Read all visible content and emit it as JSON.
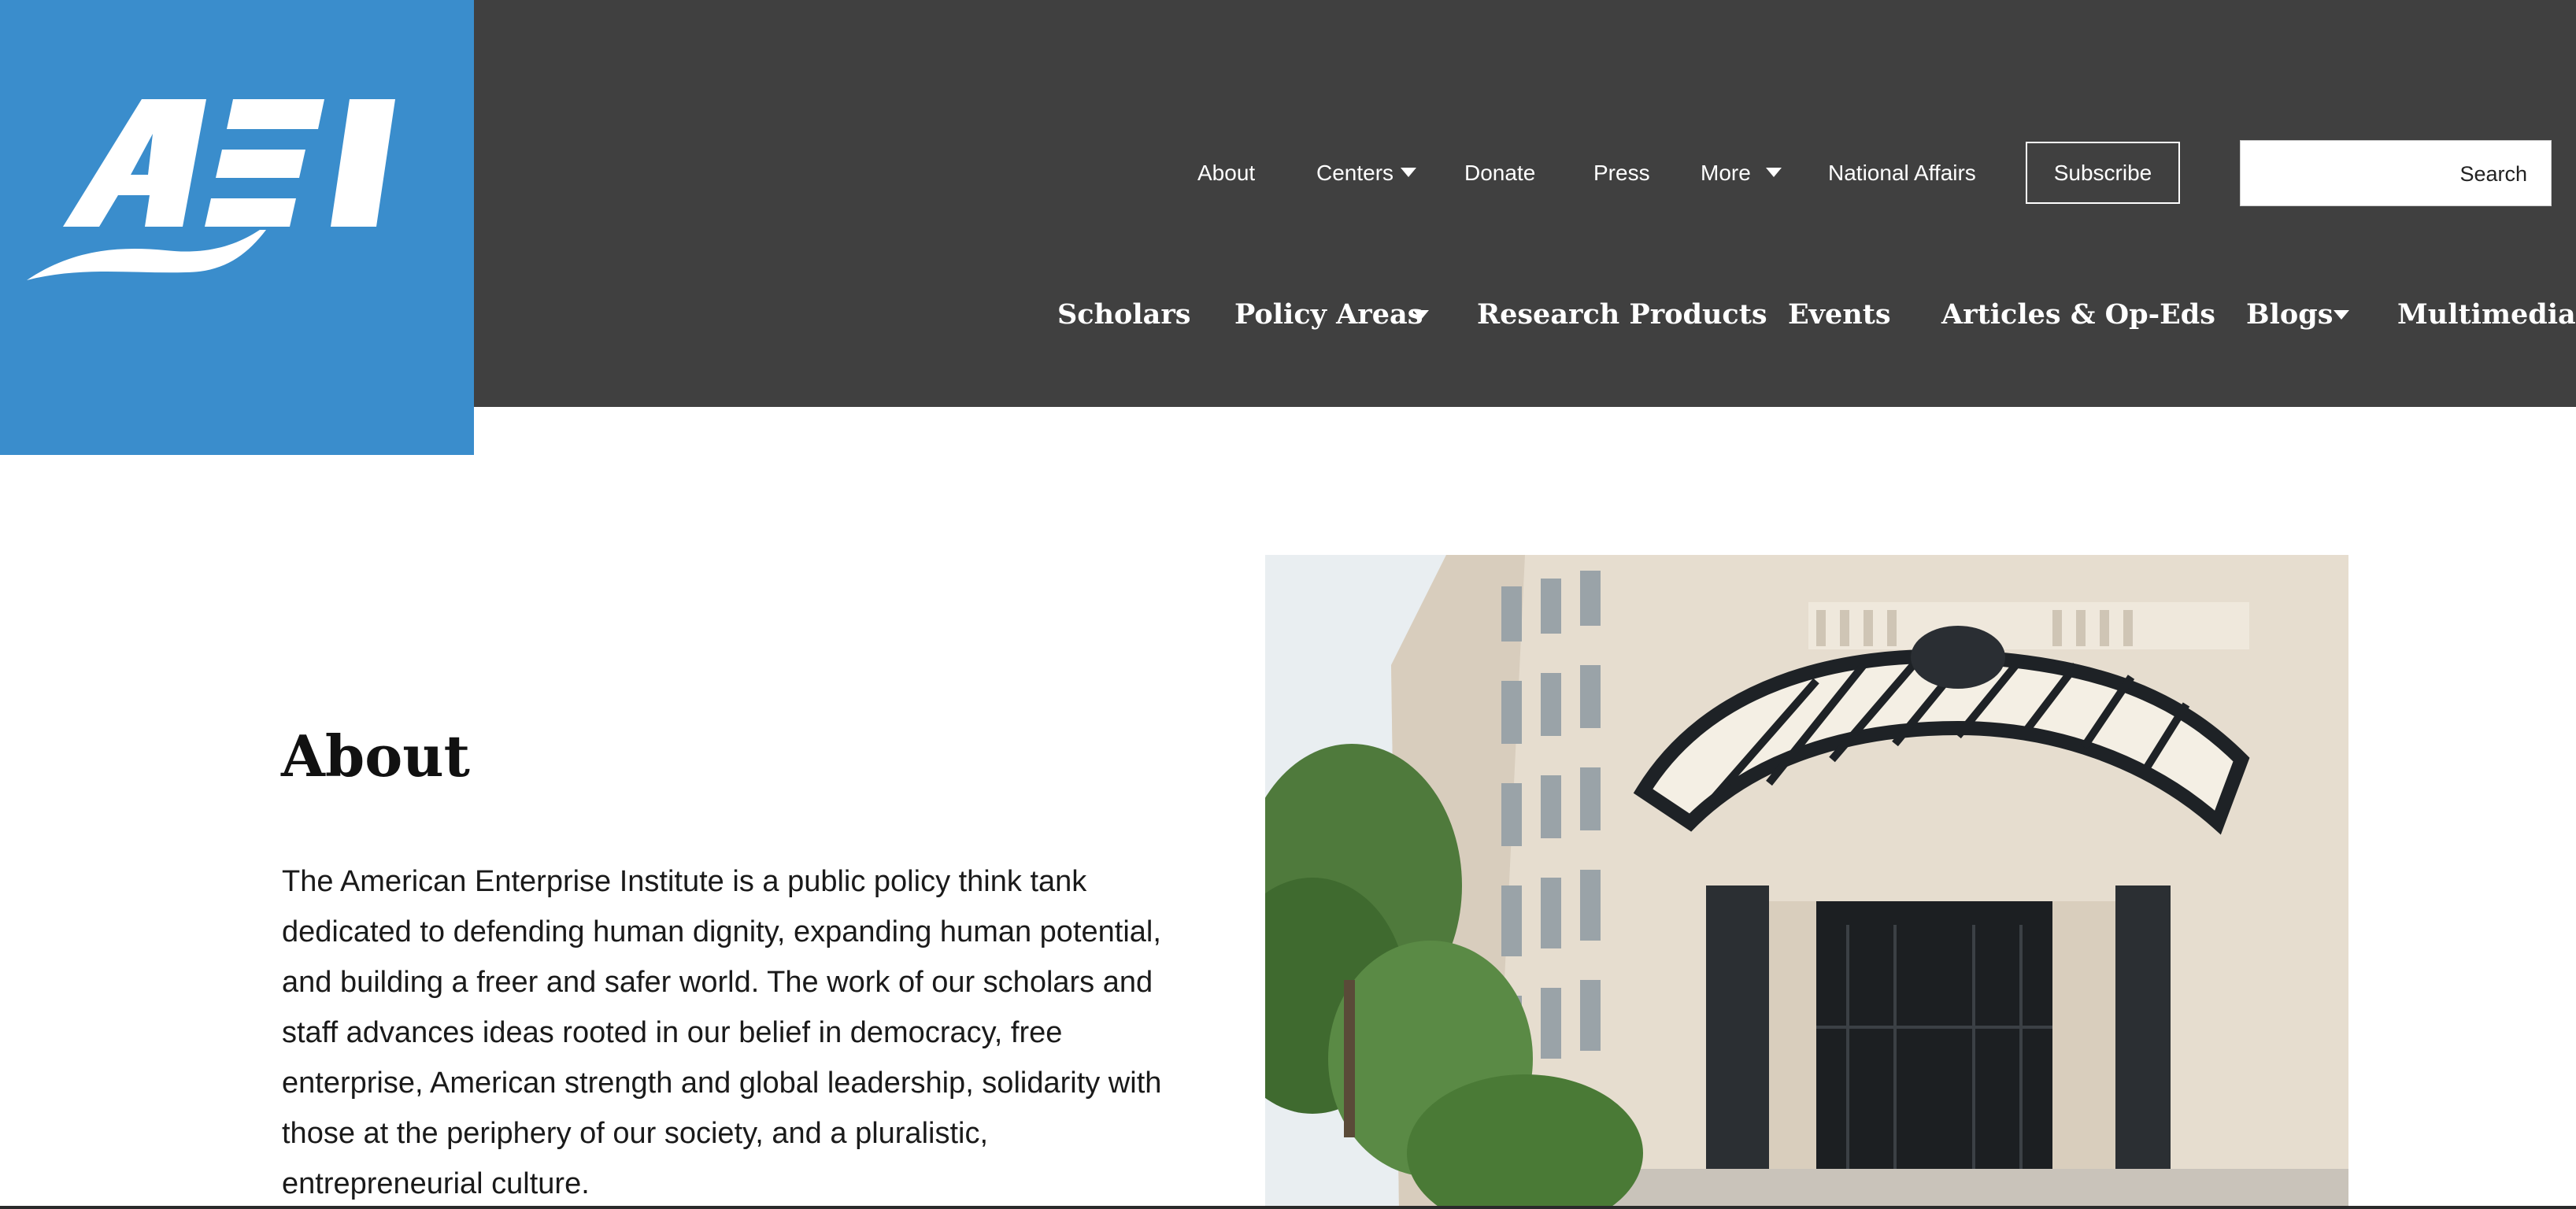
{
  "header": {
    "logo_text": "AEI",
    "utility_nav": [
      {
        "label": "About"
      },
      {
        "label": "Centers"
      },
      {
        "label": "Donate"
      },
      {
        "label": "Press"
      },
      {
        "label": "More"
      },
      {
        "label": "National Affairs"
      }
    ],
    "subscribe_label": "Subscribe",
    "search_label": "Search",
    "main_nav": [
      {
        "label": "Scholars"
      },
      {
        "label": "Policy Areas"
      },
      {
        "label": "Research Products"
      },
      {
        "label": "Events"
      },
      {
        "label": "Articles & Op-Eds"
      },
      {
        "label": "Blogs"
      },
      {
        "label": "Multimedia"
      }
    ]
  },
  "main": {
    "title": "About",
    "body": "The American Enterprise Institute is a public policy think tank dedicated to defending human dignity, expanding human potential, and building a freer and safer world. The work of our scholars and staff advances ideas rooted in our belief in democracy, free enterprise, American strength and global leadership, solidarity with those at the periphery of our society, and a pluralistic, entrepreneurial culture."
  },
  "colors": {
    "header_bg": "#404040",
    "brand_blue": "#3a8dcc",
    "nav_text": "#ffffff"
  }
}
